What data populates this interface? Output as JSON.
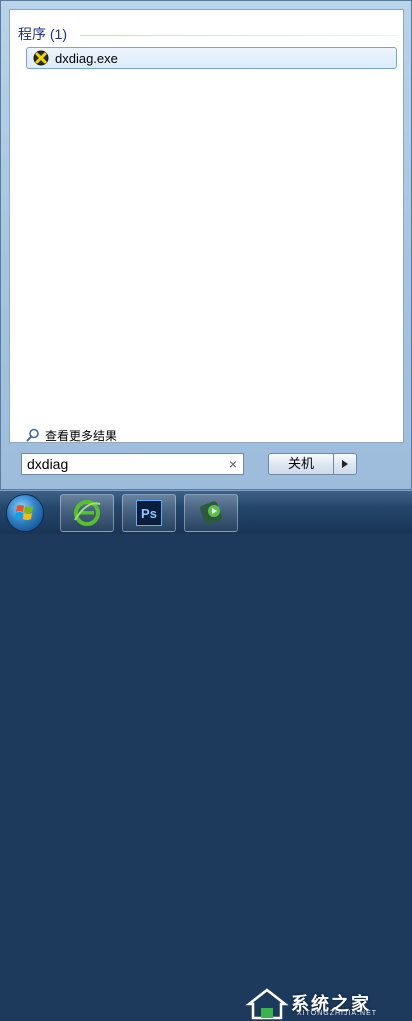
{
  "results": {
    "group_header": "程序 (1)",
    "items": [
      {
        "label": "dxdiag.exe",
        "icon": "directx-icon"
      }
    ]
  },
  "more_results": {
    "label": "查看更多结果",
    "icon": "search-icon"
  },
  "search": {
    "value": "dxdiag",
    "clear_glyph": "×"
  },
  "shutdown": {
    "label": "关机",
    "arrow_icon": "arrow-right-icon"
  },
  "taskbar": {
    "items": [
      {
        "name": "start-orb",
        "icon": "windows-logo-icon"
      },
      {
        "name": "ie",
        "icon": "internet-explorer-icon"
      },
      {
        "name": "photoshop",
        "icon": "photoshop-icon",
        "text": "Ps"
      },
      {
        "name": "app",
        "icon": "media-player-icon"
      }
    ]
  },
  "watermark": {
    "text": "系统之家",
    "sub": "XITONGZHIJIA.NET"
  },
  "colors": {
    "accent": "#1e3287",
    "taskbar": "#24456a",
    "selection": "#dcebfc"
  }
}
